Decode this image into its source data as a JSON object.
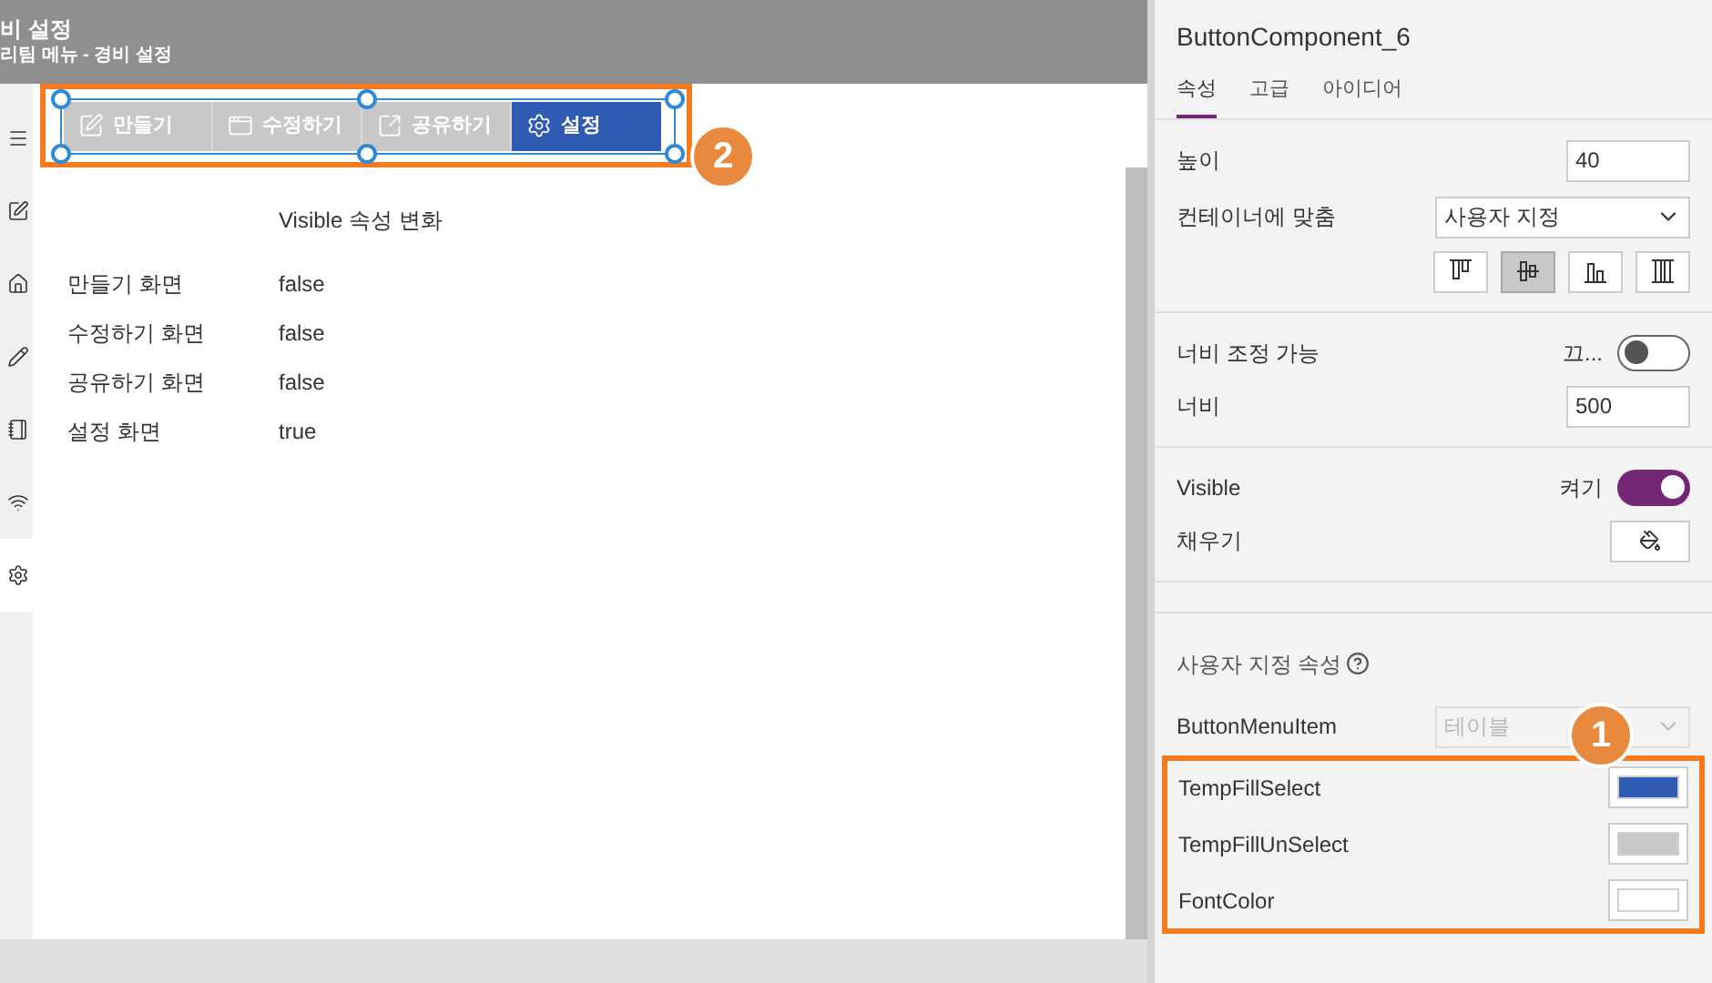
{
  "header": {
    "title": "비 설정",
    "subtitle": "리팀 메뉴 - 경비 설정"
  },
  "sidebar": {
    "items": [
      {
        "kind": "menu",
        "selected": false
      },
      {
        "kind": "edit",
        "selected": false
      },
      {
        "kind": "home",
        "selected": false
      },
      {
        "kind": "pencil",
        "selected": false
      },
      {
        "kind": "notebook",
        "selected": false
      },
      {
        "kind": "wifi",
        "selected": false
      },
      {
        "kind": "settings",
        "selected": true
      }
    ]
  },
  "menu": {
    "buttons": [
      {
        "label": "만들기",
        "kind": "create",
        "selected": false
      },
      {
        "label": "수정하기",
        "kind": "window",
        "selected": false
      },
      {
        "label": "공유하기",
        "kind": "share",
        "selected": false
      },
      {
        "label": "설정",
        "kind": "settings",
        "selected": true
      }
    ]
  },
  "callouts": [
    {
      "label": "2"
    },
    {
      "label": "1"
    }
  ],
  "table": {
    "title": "Visible 속성 변화",
    "rows": [
      {
        "label": "만들기 화면",
        "value": "false"
      },
      {
        "label": "수정하기 화면",
        "value": "false"
      },
      {
        "label": "공유하기 화면",
        "value": "false"
      },
      {
        "label": "설정 화면",
        "value": "true"
      }
    ]
  },
  "panel": {
    "component": "ButtonComponent_6",
    "tabs": [
      {
        "label": "속성",
        "selected": true
      },
      {
        "label": "고급",
        "selected": false
      },
      {
        "label": "아이디어",
        "selected": false
      }
    ],
    "height": {
      "label": "높이",
      "value": "40"
    },
    "fit": {
      "label": "컨테이너에 맞춤",
      "value": "사용자 지정"
    },
    "align": [
      {
        "kind": "top",
        "selected": false
      },
      {
        "kind": "middle",
        "selected": true
      },
      {
        "kind": "bottom",
        "selected": false
      },
      {
        "kind": "stretch",
        "selected": false
      }
    ],
    "resizable": {
      "label": "너비 조정 가능",
      "state": "끄...",
      "on": false
    },
    "width": {
      "label": "너비",
      "value": "500"
    },
    "visible": {
      "label": "Visible",
      "state": "켜기",
      "on": true
    },
    "fill": {
      "label": "채우기"
    },
    "custom": {
      "title": "사용자 지정 속성",
      "menu_item": {
        "label": "ButtonMenuItem",
        "value": "테이블",
        "disabled": true
      },
      "colors": [
        {
          "label": "TempFillSelect",
          "color": "#2f5bb5"
        },
        {
          "label": "TempFillUnSelect",
          "color": "#c8c8c8"
        },
        {
          "label": "FontColor",
          "color": "#ffffff"
        }
      ]
    }
  }
}
